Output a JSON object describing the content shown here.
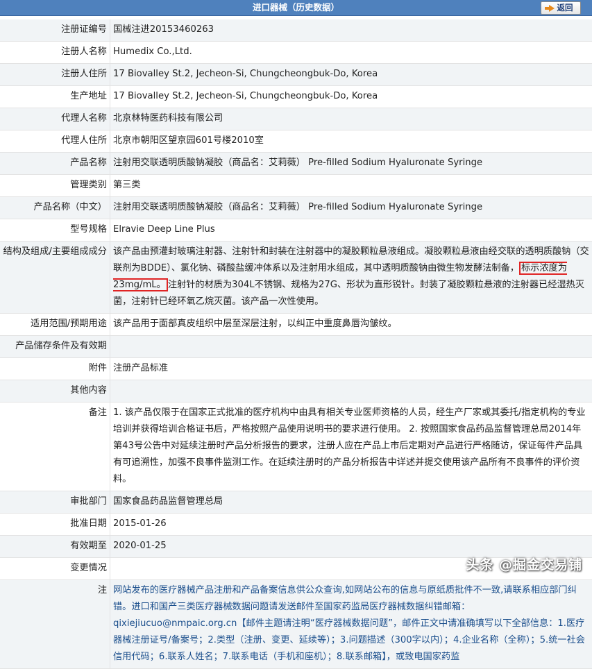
{
  "header": {
    "title": "进口器械（历史数据）",
    "back_label": "返回"
  },
  "rows": [
    {
      "label": "注册证编号",
      "value": "国械注进20153460263"
    },
    {
      "label": "注册人名称",
      "value": "Humedix Co.,Ltd."
    },
    {
      "label": "注册人住所",
      "value": "17 Biovalley St.2, Jecheon-Si, Chungcheongbuk-Do, Korea"
    },
    {
      "label": "生产地址",
      "value": "17 Biovalley St.2, Jecheon-Si, Chungcheongbuk-Do, Korea"
    },
    {
      "label": "代理人名称",
      "value": "北京林特医药科技有限公司"
    },
    {
      "label": "代理人住所",
      "value": "北京市朝阳区望京园601号楼2010室"
    },
    {
      "label": "产品名称",
      "value": "注射用交联透明质酸钠凝胶（商品名：艾莉薇） Pre-filled Sodium Hyaluronate Syringe"
    },
    {
      "label": "管理类别",
      "value": "第三类"
    },
    {
      "label": "产品名称（中文）",
      "value": "注射用交联透明质酸钠凝胶（商品名：艾莉薇） Pre-filled Sodium Hyaluronate Syringe"
    },
    {
      "label": "型号规格",
      "value": "Elravie Deep Line Plus"
    },
    {
      "label": "结构及组成/主要组成成分",
      "value_pre": "该产品由预灌封玻璃注射器、注射针和封装在注射器中的凝胶颗粒悬液组成。凝胶颗粒悬液由经交联的透明质酸钠（交联剂为BDDE）、氯化钠、磷酸盐缓冲体系以及注射用水组成，其中透明质酸钠由微生物发酵法制备，",
      "value_highlight": "标示浓度为23mg/mL。",
      "value_post": "注射针的材质为304L不锈钢、规格为27G、形状为直形锐针。封装了凝胶颗粒悬液的注射器已经湿热灭菌，注射针已经环氧乙烷灭菌。该产品一次性使用。"
    },
    {
      "label": "适用范围/预期用途",
      "value": "该产品用于面部真皮组织中层至深层注射，以纠正中重度鼻唇沟皱纹。"
    },
    {
      "label": "产品储存条件及有效期",
      "value": ""
    },
    {
      "label": "附件",
      "value": "注册产品标准"
    },
    {
      "label": "其他内容",
      "value": ""
    },
    {
      "label": "备注",
      "value": "1. 该产品仅限于在国家正式批准的医疗机构中由具有相关专业医师资格的人员，经生产厂家或其委托/指定机构的专业培训并获得培训合格证书后，严格按照产品使用说明书的要求进行使用。 2. 按照国家食品药品监督管理总局2014年第43号公告中对延续注册时产品分析报告的要求，注册人应在产品上市后定期对产品进行严格随访，保证每件产品具有可追溯性，加强不良事件监测工作。在延续注册时的产品分析报告中详述并提交使用该产品所有不良事件的评价资料。"
    },
    {
      "label": "审批部门",
      "value": "国家食品药品监督管理总局"
    },
    {
      "label": "批准日期",
      "value": "2015-01-26"
    },
    {
      "label": "有效期至",
      "value": "2020-01-25"
    },
    {
      "label": "变更情况",
      "value": ""
    },
    {
      "label": "注",
      "value": "网站发布的医疗器械产品注册和产品备案信息供公众查询,如网站公布的信息与原纸质批件不一致,请联系相应部门纠错。进口和国产三类医疗器械数据问题请发送邮件至国家药监局医疗器械数据纠错邮箱：qixiejiucuo@nmpaic.org.cn【邮件主题请注明“医疗器械数据问题”，邮件正文中请准确填写以下全部信息：1.医疗器械注册证号/备案号；2.类型（注册、变更、延续等）；3.问题描述（300字以内）；4.企业名称（全称）；5.统一社会信用代码；6.联系人姓名；7.联系电话（手机和座机）；8.联系邮箱】，或致电国家药监"
    }
  ],
  "watermark": "头条 @掘金交易铺"
}
